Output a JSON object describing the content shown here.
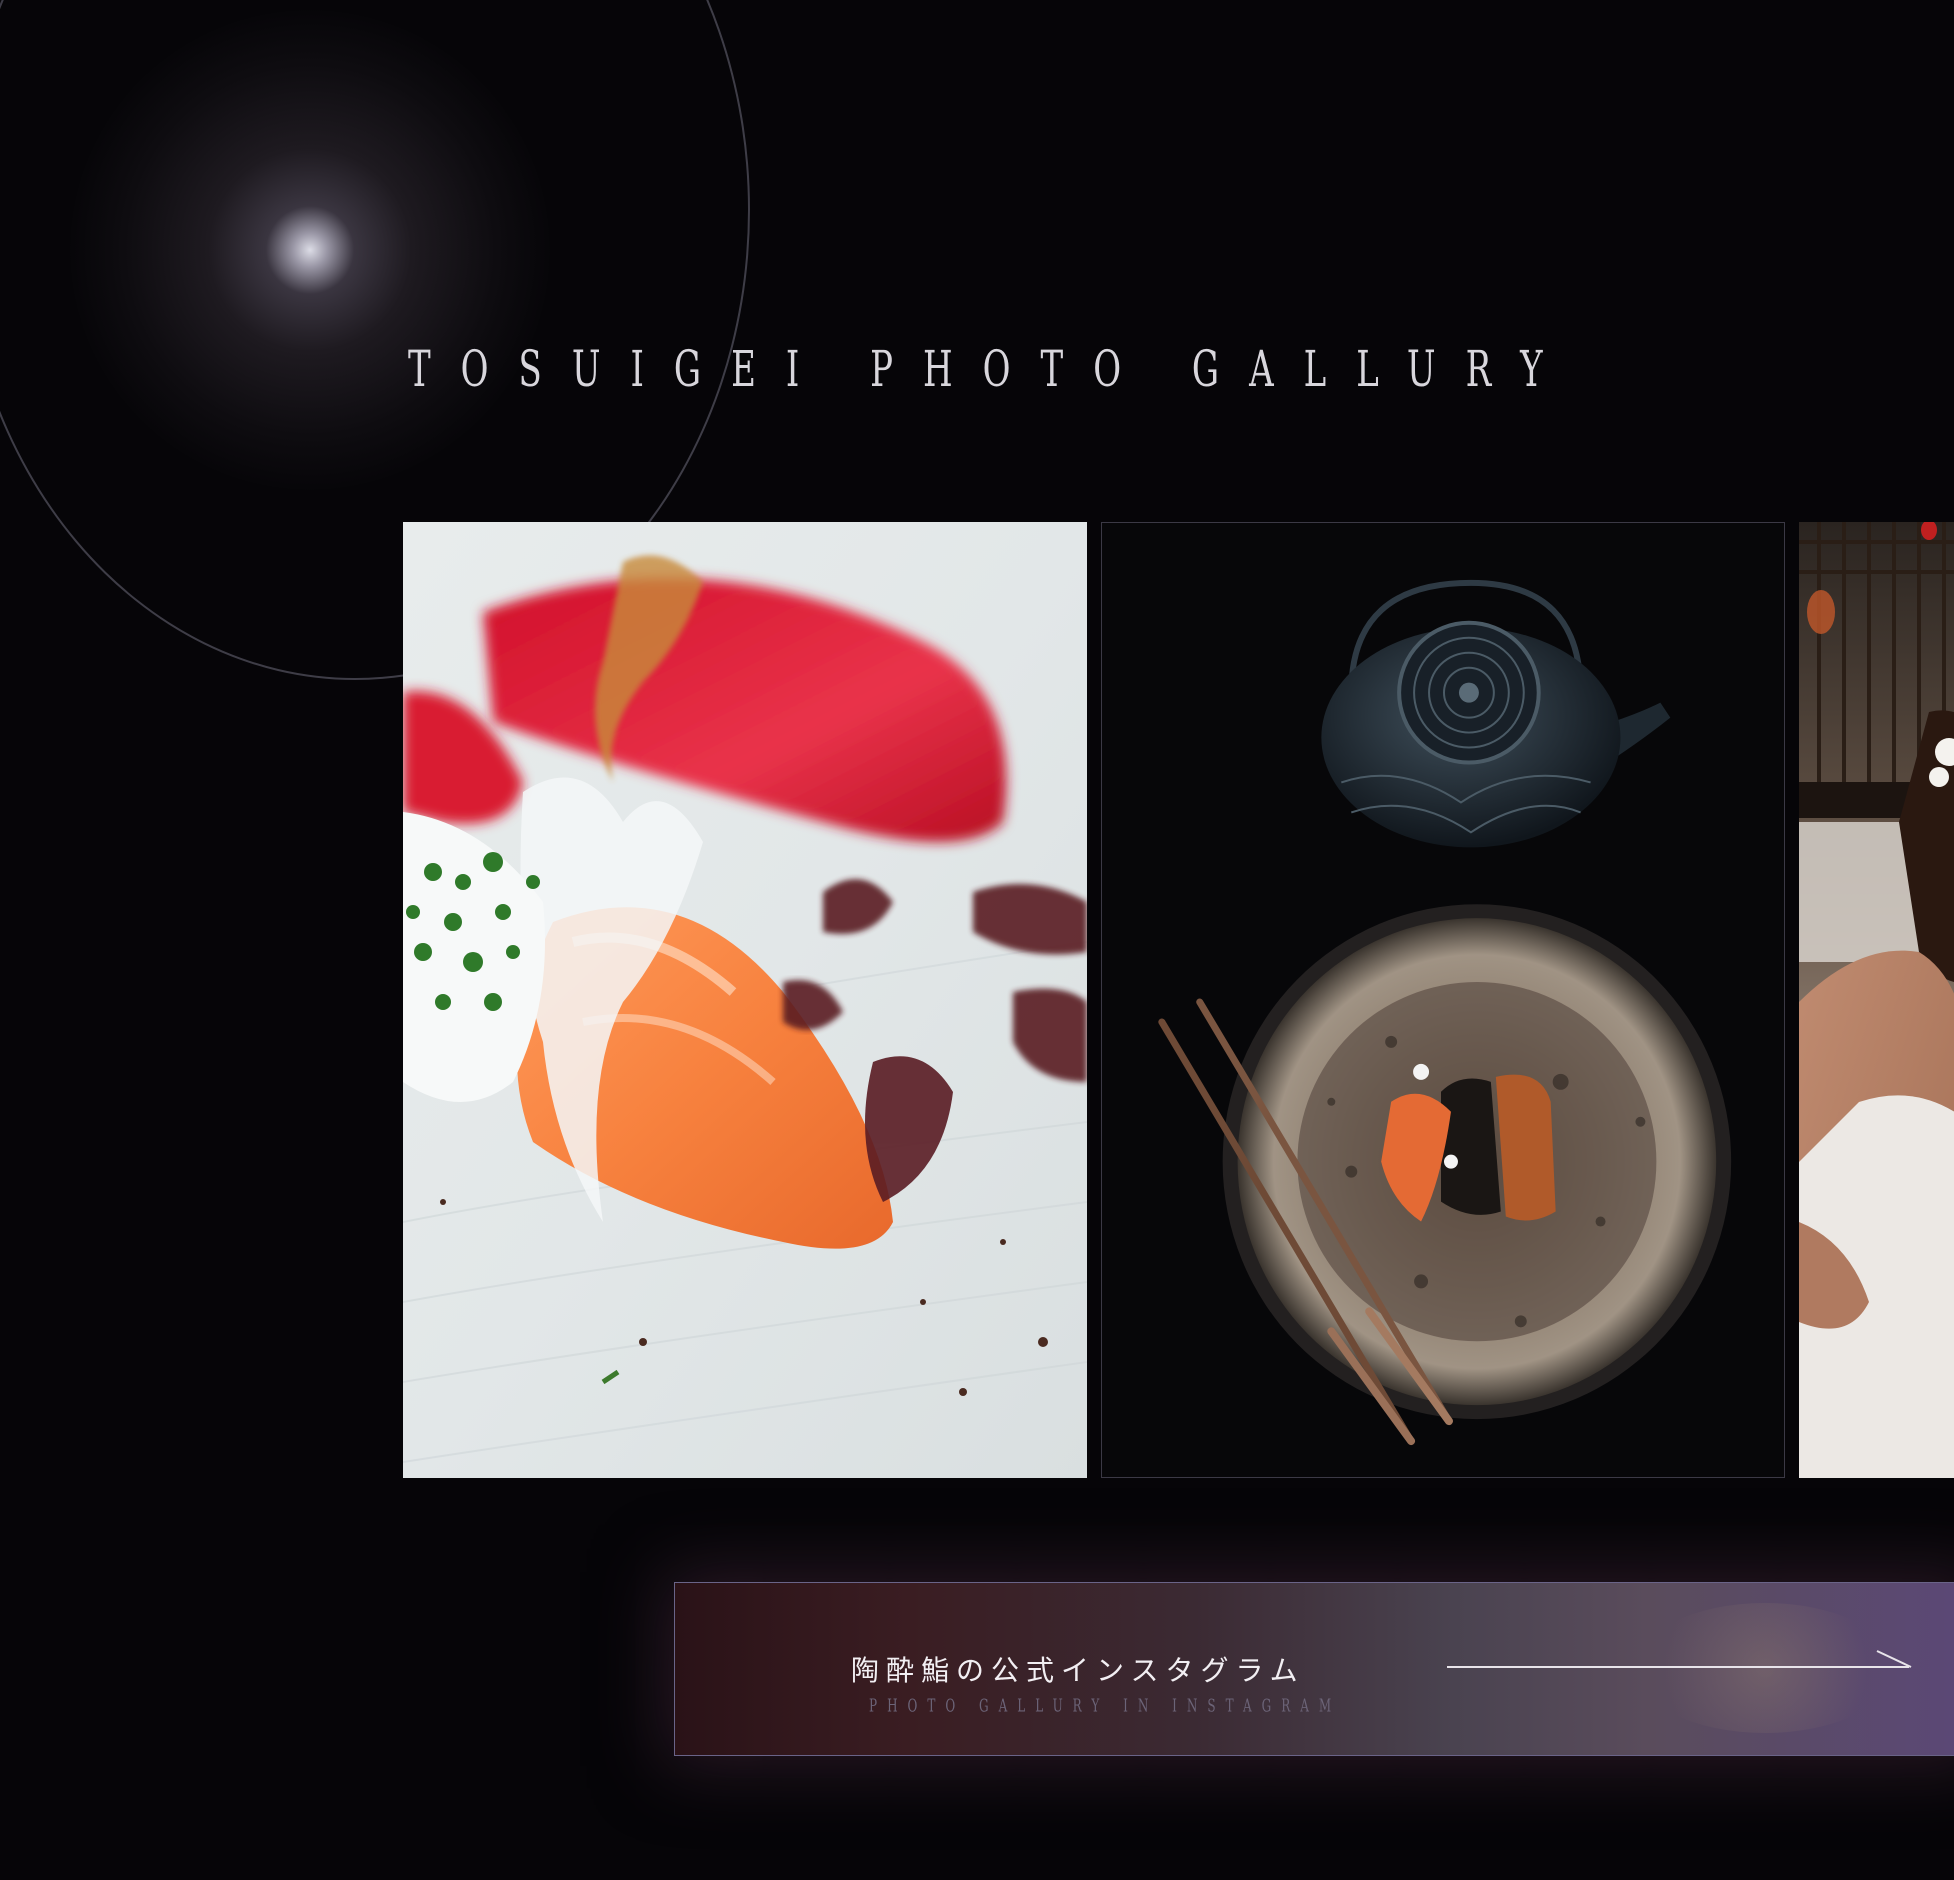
{
  "header": {
    "title": "TOSUIGEI PHOTO GALLURY"
  },
  "gallery": {
    "photos": [
      {
        "subject": "sushi-plate",
        "alt": ""
      },
      {
        "subject": "teapot-and-dish",
        "alt": ""
      },
      {
        "subject": "woman-in-white",
        "alt": ""
      }
    ]
  },
  "instagram": {
    "label": "陶酔鮨の公式インスタグラム",
    "sub_label": "PHOTO GALLURY IN INSTAGRAM",
    "arrow_icon": "arrow-right-icon"
  },
  "colors": {
    "background": "#060508",
    "title_text": "#d8d6dc",
    "banner_border": "#6a6488",
    "banner_left": "#2a1217",
    "banner_right": "#5b4877"
  }
}
